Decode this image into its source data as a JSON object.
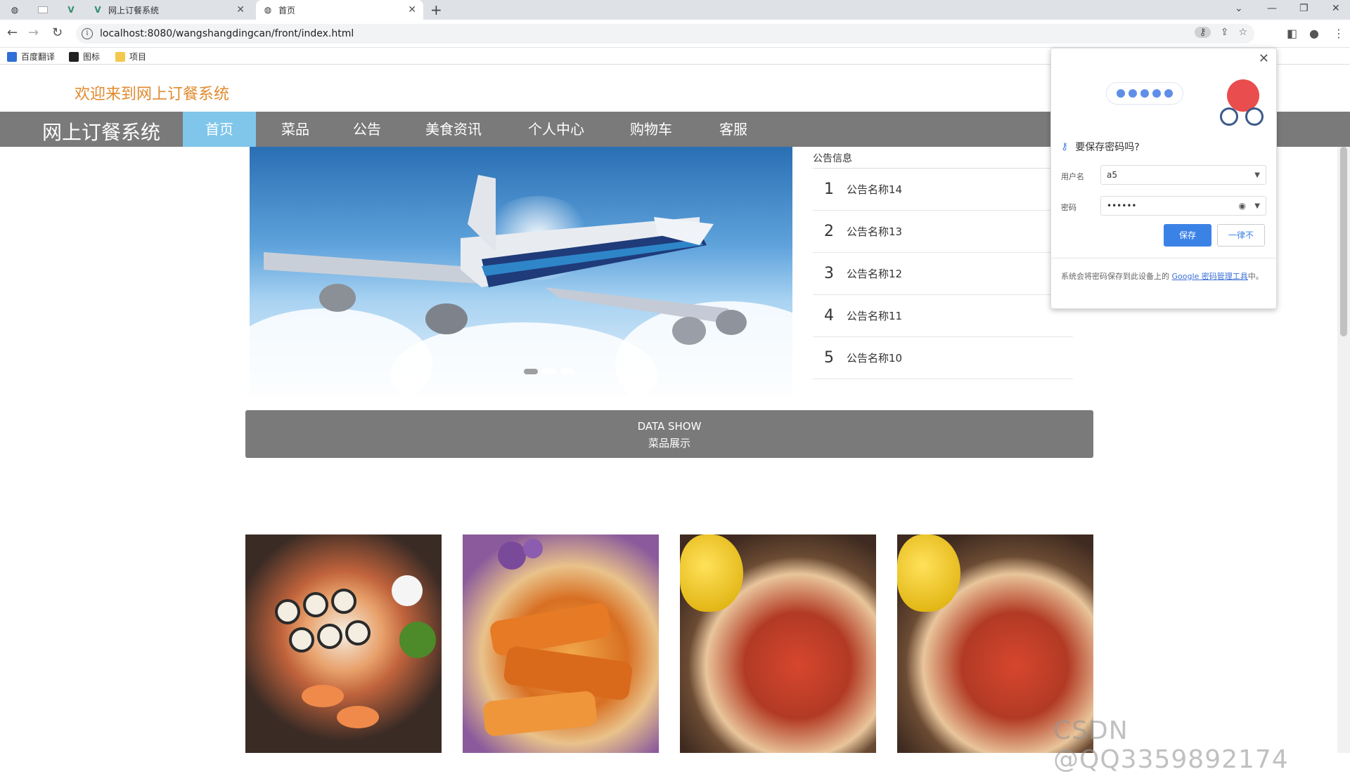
{
  "browser": {
    "tabs": [
      {
        "label": "网上订餐系统",
        "favicon": "vue-icon"
      },
      {
        "label": "首页",
        "favicon": "globe-icon",
        "active": true
      }
    ],
    "url": "localhost:8080/wangshangdingcan/front/index.html",
    "bookmarks": [
      {
        "label": "百度翻译"
      },
      {
        "label": "图标"
      },
      {
        "label": "项目"
      }
    ]
  },
  "site": {
    "welcome": "欢迎来到网上订餐系统",
    "brand": "网上订餐系统",
    "nav": [
      {
        "label": "首页",
        "active": true
      },
      {
        "label": "菜品"
      },
      {
        "label": "公告"
      },
      {
        "label": "美食资讯"
      },
      {
        "label": "个人中心"
      },
      {
        "label": "购物车"
      },
      {
        "label": "客服"
      }
    ],
    "carousel": {
      "slide_count": 3,
      "active_index": 1
    },
    "notice": {
      "title": "公告信息",
      "items": [
        {
          "num": "1",
          "name": "公告名称14"
        },
        {
          "num": "2",
          "name": "公告名称13"
        },
        {
          "num": "3",
          "name": "公告名称12"
        },
        {
          "num": "4",
          "name": "公告名称11"
        },
        {
          "num": "5",
          "name": "公告名称10"
        }
      ]
    },
    "datashow": {
      "line1": "DATA SHOW",
      "line2": "菜品展示"
    }
  },
  "password_popup": {
    "question": "要保存密码吗?",
    "username_label": "用户名",
    "username_value": "a5",
    "password_label": "密码",
    "password_value": "••••••",
    "save_label": "保存",
    "never_label": "一律不",
    "footer_prefix": "系统会将密码保存到此设备上的 ",
    "footer_link": "Google 密码管理工具",
    "footer_suffix": "中。"
  },
  "watermark": "CSDN @QQ3359892174",
  "colors": {
    "nav_bg": "#7a7a7a",
    "nav_active": "#7fc6ea",
    "welcome": "#e08a2e",
    "save_button": "#3b82e6"
  }
}
